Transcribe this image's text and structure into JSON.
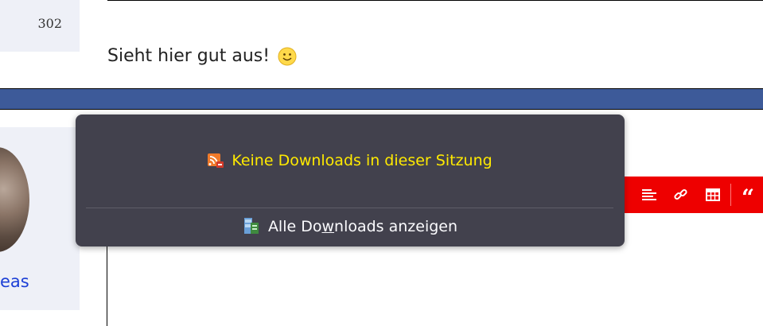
{
  "post": {
    "count": "302",
    "message": "Sieht hier gut aus!"
  },
  "user": {
    "name_fragment": "eas"
  },
  "downloads_panel": {
    "empty_message": "Keine Downloads in dieser Sitzung",
    "show_all_prefix": "Alle Do",
    "show_all_accesskey": "w",
    "show_all_suffix": "nloads anzeigen"
  },
  "toolbar": {
    "icons": [
      "align-icon",
      "link-icon",
      "table-icon",
      "quote-icon"
    ],
    "quote_glyph": "“"
  },
  "colors": {
    "toolbar_bg": "#ee0000",
    "header_bar": "#3d5a99",
    "popup_bg": "#42414d",
    "empty_text": "#ffea00",
    "username": "#1c3fd6"
  }
}
